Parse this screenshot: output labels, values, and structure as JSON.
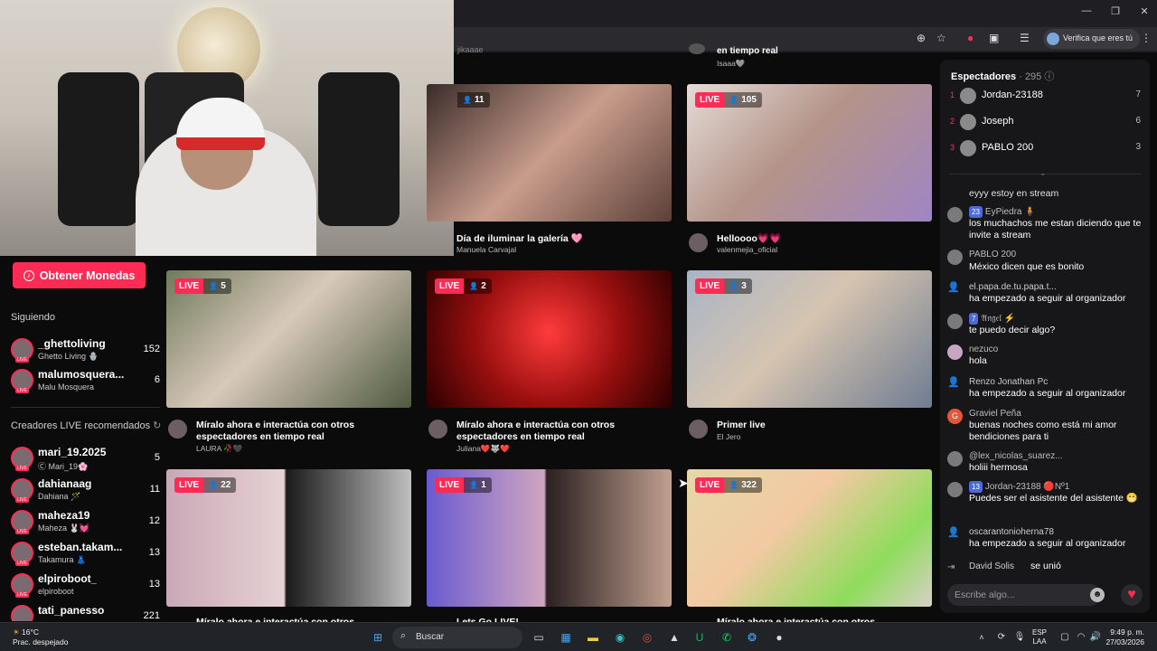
{
  "browser": {
    "verify_label": "Verifica que eres tú",
    "window_controls": [
      "—",
      "❐",
      "✕"
    ]
  },
  "top_partial": {
    "left_caption_tail": "jikaaae",
    "right_caption_tail": "en tiempo real",
    "right_sub_tail": "Isaaa🩶"
  },
  "sidebar": {
    "coins_button": "Obtener Monedas",
    "following_title": "Siguiendo",
    "following": [
      {
        "name": "_ghettoliving",
        "sub": "Ghetto Living 🪬",
        "count": "152"
      },
      {
        "name": "malumosquera...",
        "sub": "Malu Mosquera",
        "count": "6"
      }
    ],
    "recommended_title": "Creadores LIVE recomendados",
    "recommended": [
      {
        "name": "mari_19.2025",
        "sub": "Ⓒ Mari_19🌸",
        "count": "5"
      },
      {
        "name": "dahianaag",
        "sub": "Dahiana 🪄",
        "count": "11"
      },
      {
        "name": "maheza19",
        "sub": "Maheza 🐰💓",
        "count": "12"
      },
      {
        "name": "esteban.takam...",
        "sub": "Takamura 👗",
        "count": "13"
      },
      {
        "name": "elpiroboot_",
        "sub": "elpiroboot",
        "count": "13"
      },
      {
        "name": "tati_panesso",
        "sub": "",
        "count": "221"
      }
    ]
  },
  "cards": [
    {
      "viewers": "11",
      "title": "Día de iluminar la galería 🩷",
      "sub": "Manuela Carvajal"
    },
    {
      "viewers": "105",
      "title": "Helloooo💗💗",
      "sub": "valenmejia_oficial"
    },
    {
      "viewers": "5",
      "title": "Míralo ahora e interactúa con otros espectadores en tiempo real",
      "sub": "LAURA 🥀🖤"
    },
    {
      "viewers": "2",
      "title": "Míralo ahora e interactúa con otros espectadores en tiempo real",
      "sub": "Juliana❤️🐺❤️"
    },
    {
      "viewers": "3",
      "title": "Primer live",
      "sub": "El Jero"
    },
    {
      "viewers": "22",
      "title": "Míralo ahora e interactúa con otros espectadores",
      "sub": ""
    },
    {
      "viewers": "1",
      "title": "Lets Go LIVE!",
      "sub": ""
    },
    {
      "viewers": "322",
      "title": "Míralo ahora e interactúa con otros espectadores",
      "sub": ""
    }
  ],
  "live_label": "LIVE",
  "right_panel": {
    "title": "Espectadores",
    "count": "· 295",
    "ranking": [
      {
        "rank": "1",
        "name": "Jordan-23188",
        "score": "7"
      },
      {
        "rank": "2",
        "name": "Joseph",
        "score": "6"
      },
      {
        "rank": "3",
        "name": "PABLO 200",
        "score": "3"
      }
    ],
    "messages": [
      {
        "user": "",
        "text": "eyyy estoy en stream"
      },
      {
        "user": "EyPiedra 🧍",
        "level": "23",
        "text": "los muchachos me estan diciendo que te invite a stream"
      },
      {
        "user": "PABLO 200",
        "text": "México dicen que es bonito"
      },
      {
        "user": "el.papa.de.tu.papa.t...",
        "text": "ha empezado a seguir al organizador"
      },
      {
        "user": "𝔄𝔫𝔤𝔢𝔩 ⚡",
        "level": "7",
        "text": "te puedo decir algo?"
      },
      {
        "user": "nezuco",
        "text": "hola"
      },
      {
        "user": "Renzo Jonathan Pc",
        "text": "ha empezado a seguir al organizador"
      },
      {
        "user": "Graviel Peña",
        "text": "buenas noches como está mi amor bendiciones para ti"
      },
      {
        "user": "@lex_nicolas_suarez...",
        "text": "holiii hermosa"
      },
      {
        "user": "Jordan-23188 🔴Nº1",
        "level": "13",
        "text": "Puedes ser el asistente del asistente 😁"
      },
      {
        "user": "oscarantonioherna78",
        "text": "ha empezado a seguir al organizador"
      },
      {
        "user": "David Solis",
        "text": "se unió"
      }
    ],
    "input_placeholder": "Escribe algo..."
  },
  "taskbar": {
    "weather_temp": "16°C",
    "weather_desc": "Prac. despejado",
    "search": "Buscar",
    "lang1": "ESP",
    "lang2": "LAA",
    "time": "9:49 p. m.",
    "date": "27/03/2026"
  }
}
